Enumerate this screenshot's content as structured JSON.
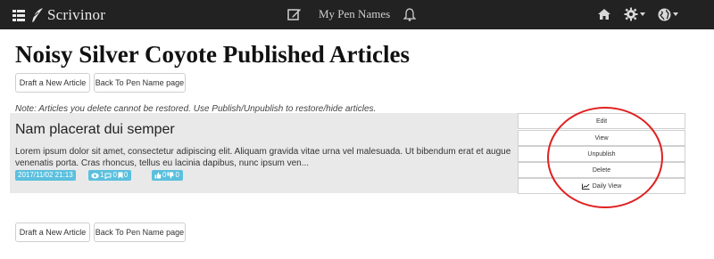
{
  "navbar": {
    "brand": "Scrivinor",
    "pen_names": "My Pen Names"
  },
  "page": {
    "title": "Noisy Silver Coyote Published Articles",
    "draft_button": "Draft a New Article",
    "back_button": "Back To Pen Name page",
    "note": "Note: Articles you delete cannot be restored. Use Publish/Unpublish to restore/hide articles."
  },
  "article": {
    "title": "Nam placerat dui semper",
    "excerpt": "Lorem ipsum dolor sit amet, consectetur adipiscing elit. Aliquam gravida vitae urna vel malesuada. Ut bibendum erat et augue venenatis porta. Cras rhoncus, tellus eu lacinia dapibus, nunc ipsum ven...",
    "date": "2017/11/02 21:13",
    "views": "1",
    "comments": "0",
    "bookmarks": "0",
    "likes": "0",
    "dislikes": "0",
    "badge_color": "#5bc0de"
  },
  "actions": {
    "edit": "Edit",
    "view": "View",
    "unpublish": "Unpublish",
    "delete": "Delete",
    "daily_view": "Daily View"
  },
  "footer": {
    "draft_button": "Draft a New Article",
    "back_button": "Back To Pen Name page"
  },
  "colors": {
    "navbar_bg": "#222222",
    "highlight": "#e02020",
    "article_bg": "#e9e9e9"
  }
}
